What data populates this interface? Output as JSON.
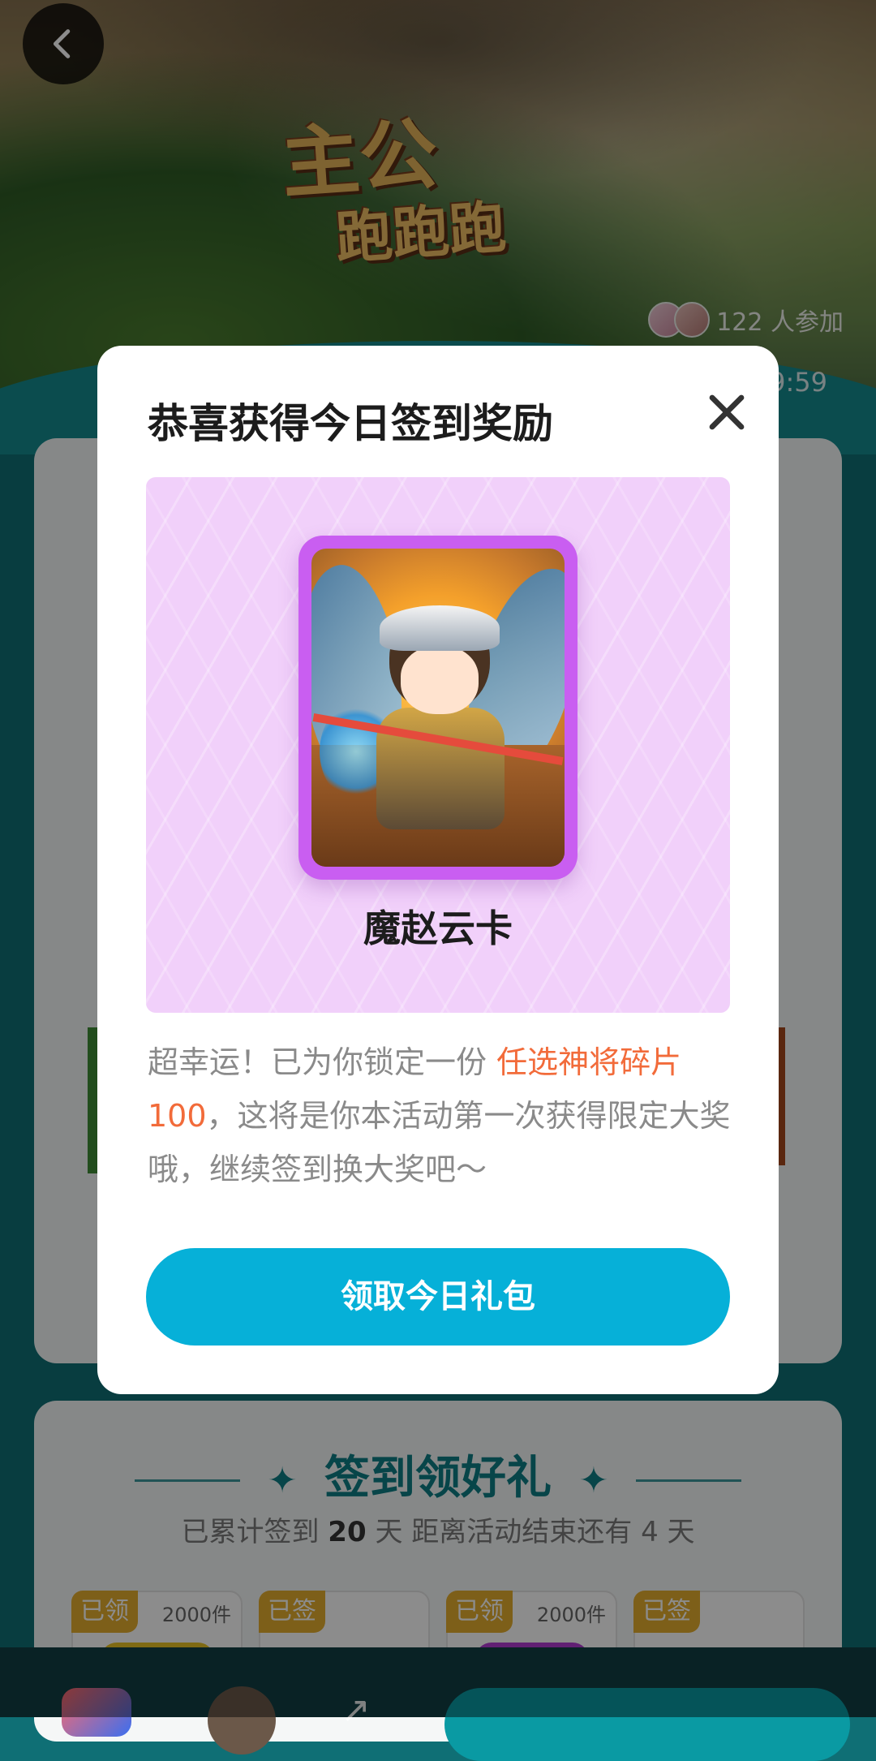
{
  "hero": {
    "title_line1": "主公",
    "title_line2": "跑跑跑",
    "participants": "122 人参加",
    "timer_peek": "9:59"
  },
  "signin": {
    "title": "签到领好礼",
    "sub_prefix": "已累计签到",
    "days_total": "20",
    "sub_mid": "天  距离活动结束还有",
    "days_left": "4",
    "sub_suffix": "天",
    "days": [
      {
        "tag": "已领",
        "count": "2000件",
        "color": "yellow"
      },
      {
        "tag": "已签",
        "count": "",
        "color": "none"
      },
      {
        "tag": "已领",
        "count": "2000件",
        "color": "purple"
      },
      {
        "tag": "已签",
        "count": "",
        "color": "none"
      }
    ]
  },
  "modal": {
    "title": "恭喜获得今日签到奖励",
    "card_name": "魔赵云卡",
    "desc_part1": "超幸运！已为你锁定一份 ",
    "desc_highlight": "任选神将碎片100",
    "desc_part2": "，这将是你本活动第一次获得限定大奖哦，继续签到换大奖吧～",
    "claim_button": "领取今日礼包"
  },
  "icons": {
    "back": "chevron-left-icon",
    "close": "close-icon",
    "share": "share-icon"
  },
  "colors": {
    "accent": "#06b0d8",
    "highlight": "#f26b3a",
    "reward_panel": "#f1d0fa",
    "card_frame": "#c95ef1",
    "teal": "#0e7f86"
  }
}
